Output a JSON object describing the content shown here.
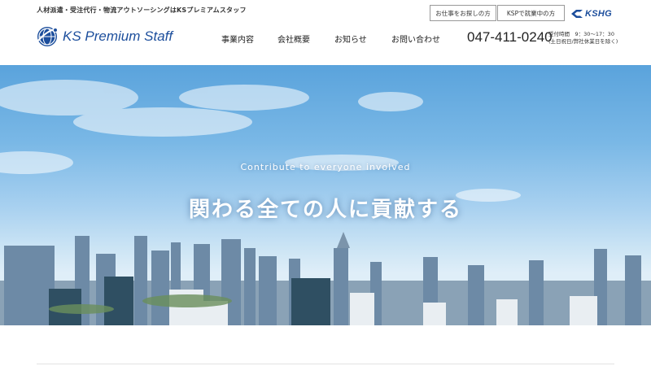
{
  "header": {
    "tagline": "人材派遣・受注代行・物流アウトソーシングはKSプレミアムスタッフ",
    "utility_buttons": [
      {
        "label": "お仕事をお探しの方"
      },
      {
        "label": "KSPで就業中の方"
      }
    ],
    "group_logo_text": "KSHG",
    "logo_text": "KS Premium Staff",
    "nav": [
      {
        "label": "事業内容"
      },
      {
        "label": "会社概要"
      },
      {
        "label": "お知らせ"
      },
      {
        "label": "お問い合わせ"
      }
    ],
    "phone": "047-411-0240",
    "hours_line1": "受付時間　9：30〜17：30",
    "hours_line2": "(土日祝日/弊社休業日を除く)",
    "brand_color": "#1c4e9c"
  },
  "hero": {
    "subtitle": "Contribute to everyone involved",
    "title": "関わる全ての人に貢献する"
  }
}
